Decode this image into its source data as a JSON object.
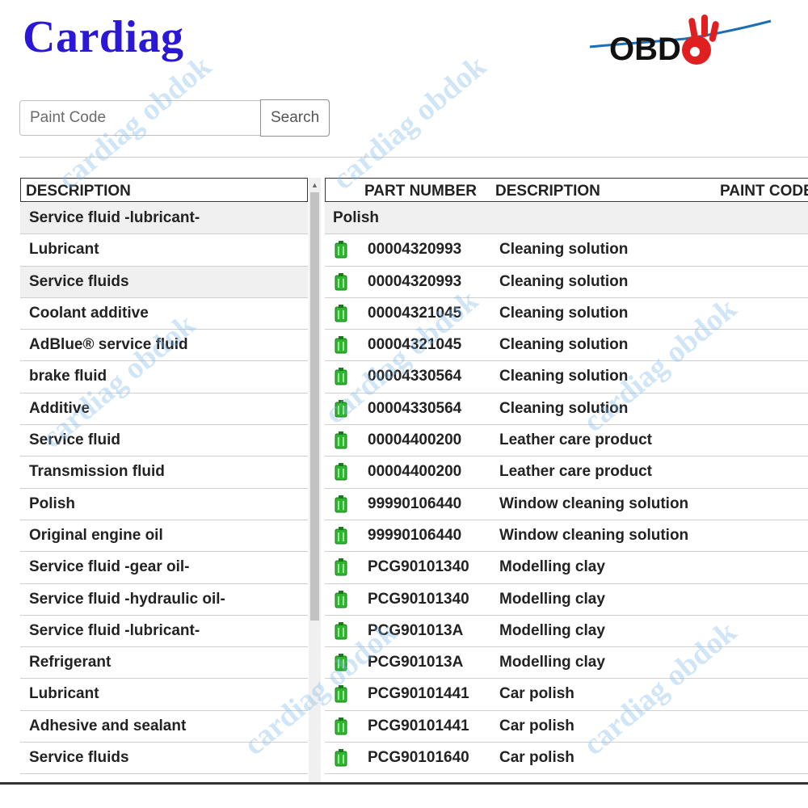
{
  "brand": "Cardiag",
  "logo_text": "OBD",
  "search": {
    "placeholder": "Paint Code",
    "button": "Search"
  },
  "left": {
    "header": "DESCRIPTION",
    "items": [
      "Service fluid -lubricant-",
      "Lubricant",
      "Service fluids",
      "Coolant additive",
      "AdBlue® service fluid",
      "brake fluid",
      "Additive",
      "Service fluid",
      "Transmission fluid",
      "Polish",
      "Original engine oil",
      "Service fluid -gear oil-",
      "Service fluid -hydraulic oil-",
      "Service fluid -lubricant-",
      "Refrigerant",
      "Lubricant",
      "Adhesive and sealant",
      "Service fluids"
    ]
  },
  "right": {
    "headers": {
      "part_number": "PART NUMBER",
      "description": "DESCRIPTION",
      "paint_code": "PAINT CODE"
    },
    "group": "Polish",
    "rows": [
      {
        "part_number": "00004320993",
        "description": "Cleaning solution"
      },
      {
        "part_number": "00004320993",
        "description": "Cleaning solution"
      },
      {
        "part_number": "00004321045",
        "description": "Cleaning solution"
      },
      {
        "part_number": "00004321045",
        "description": "Cleaning solution"
      },
      {
        "part_number": "00004330564",
        "description": "Cleaning solution"
      },
      {
        "part_number": "00004330564",
        "description": "Cleaning solution"
      },
      {
        "part_number": "00004400200",
        "description": "Leather care product"
      },
      {
        "part_number": "00004400200",
        "description": "Leather care product"
      },
      {
        "part_number": "99990106440",
        "description": "Window cleaning solution"
      },
      {
        "part_number": "99990106440",
        "description": "Window cleaning solution"
      },
      {
        "part_number": "PCG90101340",
        "description": "Modelling clay"
      },
      {
        "part_number": "PCG90101340",
        "description": "Modelling clay"
      },
      {
        "part_number": "PCG901013A",
        "description": "Modelling clay"
      },
      {
        "part_number": "PCG901013A",
        "description": "Modelling clay"
      },
      {
        "part_number": "PCG90101441",
        "description": "Car polish"
      },
      {
        "part_number": "PCG90101441",
        "description": "Car polish"
      },
      {
        "part_number": "PCG90101640",
        "description": "Car polish"
      }
    ]
  },
  "watermark": "cardiag obdok",
  "colors": {
    "brand": "#2a17d8",
    "logo_red": "#e02020",
    "icon_green": "#2fb52f",
    "watermark": "#78b4e6"
  }
}
